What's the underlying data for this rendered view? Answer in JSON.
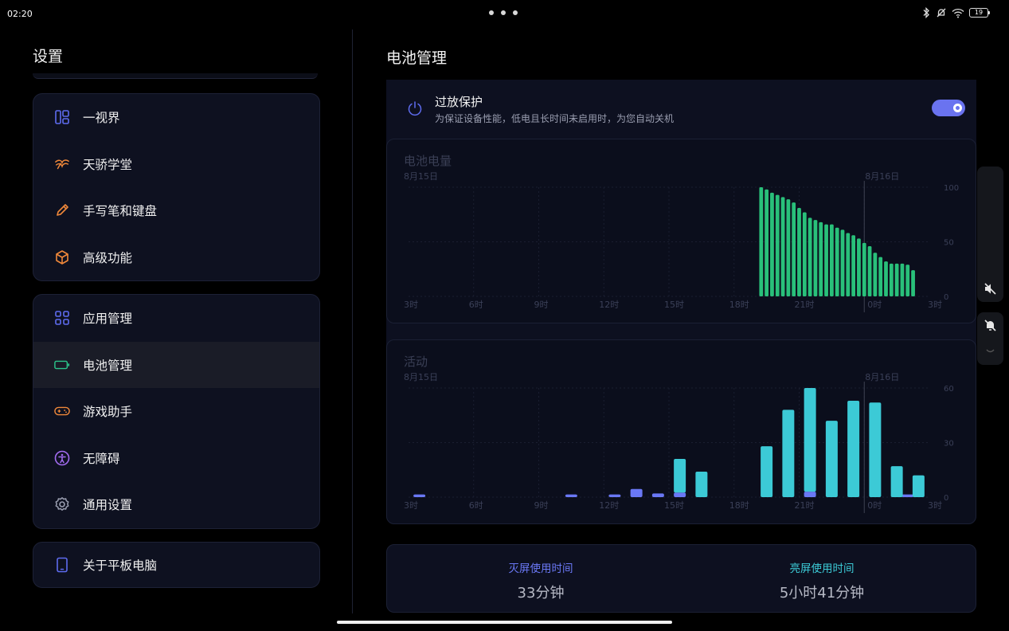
{
  "status": {
    "time": "02:20",
    "battery": "19"
  },
  "left": {
    "title": "设置",
    "group1": [
      {
        "label": "一视界",
        "icon": "layout-icon",
        "color": "#5e6cf0"
      },
      {
        "label": "天骄学堂",
        "icon": "education-icon",
        "color": "#f0883a"
      },
      {
        "label": "手写笔和键盘",
        "icon": "pen-icon",
        "color": "#f0883a"
      },
      {
        "label": "高级功能",
        "icon": "cube-icon",
        "color": "#f0883a"
      }
    ],
    "group2": [
      {
        "label": "应用管理",
        "icon": "apps-grid-icon",
        "color": "#5e6cf0"
      },
      {
        "label": "电池管理",
        "icon": "battery-icon",
        "color": "#2bc48a"
      },
      {
        "label": "游戏助手",
        "icon": "gamepad-icon",
        "color": "#f0883a"
      },
      {
        "label": "无障碍",
        "icon": "accessibility-icon",
        "color": "#a26cf0"
      },
      {
        "label": "通用设置",
        "icon": "gear-icon",
        "color": "#9a9eb0"
      }
    ],
    "group3": [
      {
        "label": "关于平板电脑",
        "icon": "tablet-icon",
        "color": "#5e6cf0"
      }
    ]
  },
  "right": {
    "title": "电池管理",
    "protection": {
      "title": "过放保护",
      "desc": "为保证设备性能，低电且长时间未启用时，为您自动关机",
      "enabled": true
    },
    "usage": {
      "screen_off_label": "灭屏使用时间",
      "screen_off_value": "33分钟",
      "screen_on_label": "亮屏使用时间",
      "screen_on_value": "5小时41分钟",
      "screen_off_color": "#6a78f5",
      "screen_on_color": "#3ccad6"
    }
  },
  "chart_data": [
    {
      "type": "bar",
      "title": "电池电量",
      "date_labels": [
        "8月15日",
        "8月16日"
      ],
      "x_ticks": [
        "3时",
        "6时",
        "9时",
        "12时",
        "15时",
        "18时",
        "21时",
        "0时",
        "3时"
      ],
      "y_ticks": [
        "100",
        "50",
        "0"
      ],
      "ylim": [
        0,
        100
      ],
      "x_range": [
        3,
        27
      ],
      "x_unit": "hours since 0时 on 8月15日",
      "color": "#29c07a",
      "x": [
        19.25,
        19.5,
        19.75,
        20,
        20.25,
        20.5,
        20.75,
        21,
        21.25,
        21.5,
        21.75,
        22,
        22.25,
        22.5,
        22.75,
        23,
        23.25,
        23.5,
        23.75,
        24,
        24.25,
        24.5,
        24.75,
        25,
        25.25,
        25.5,
        25.75,
        26,
        26.25
      ],
      "values": [
        100,
        98,
        95,
        93,
        91,
        89,
        86,
        81,
        77,
        72,
        70,
        68,
        66,
        66,
        63,
        61,
        58,
        56,
        53,
        49,
        46,
        40,
        36,
        32,
        30,
        30,
        30,
        29,
        24
      ]
    },
    {
      "type": "bar",
      "title": "活动",
      "date_labels": [
        "8月15日",
        "8月16日"
      ],
      "x_ticks": [
        "3时",
        "6时",
        "9时",
        "12时",
        "15时",
        "18时",
        "21时",
        "0时",
        "3时"
      ],
      "y_ticks": [
        "60",
        "30",
        "0"
      ],
      "ylim": [
        0,
        60
      ],
      "x_range": [
        3,
        27
      ],
      "x_unit": "hours since 0时 on 8月15日",
      "series": [
        {
          "name": "灭屏使用时间",
          "color": "#6a78f5",
          "x": [
            3.5,
            10.5,
            12.5,
            13.5,
            14.5,
            15.5,
            21.5,
            26.0
          ],
          "values": [
            1.5,
            1.5,
            1.5,
            4.5,
            2,
            2.5,
            3,
            1.5
          ]
        },
        {
          "name": "亮屏使用时间",
          "color": "#3ccad6",
          "x": [
            15.5,
            16.5,
            19.5,
            20.5,
            21.5,
            22.5,
            23.5,
            24.5,
            25.5,
            26.5
          ],
          "values": [
            21,
            14,
            28,
            48,
            60,
            42,
            53,
            52,
            17,
            12
          ]
        }
      ]
    }
  ]
}
